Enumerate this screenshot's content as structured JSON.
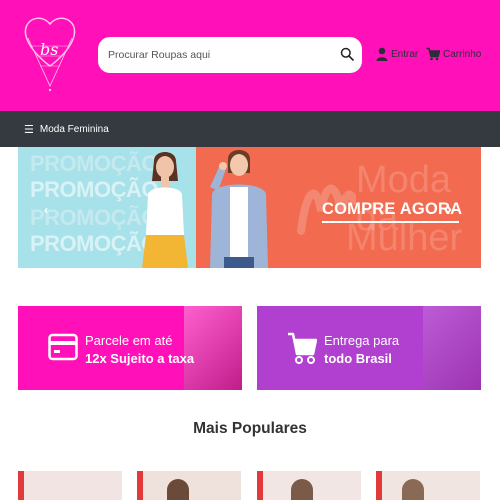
{
  "header": {
    "logo_text": "bs",
    "search_placeholder": "Procurar Roupas aqui",
    "login_label": "Entrar",
    "cart_label": "Carrinho"
  },
  "nav": {
    "menu_label": "Moda Feminina"
  },
  "hero": {
    "promo_words": [
      "PROMOÇÃO",
      "PROMOÇÃO",
      "PROMOÇÃO",
      "PROMOÇÃO"
    ],
    "ghost_text_1": "Moda da",
    "ghost_text_2": "Mulher",
    "cta_label": "COMPRE AGORA"
  },
  "cards": [
    {
      "line1": "Parcele em até",
      "line2": "12x Sujeito a taxa",
      "icon": "credit-card-icon"
    },
    {
      "line1": "Entrega para",
      "line2": "todo Brasil",
      "icon": "shopping-cart-icon"
    }
  ],
  "section": {
    "title": "Mais Populares"
  },
  "colors": {
    "brand_pink": "#ff10b8",
    "nav_dark": "#343a40",
    "card_purple": "#b13fd0",
    "hero_orange": "#f26a4f",
    "hero_cyan": "#a7e1ea"
  }
}
